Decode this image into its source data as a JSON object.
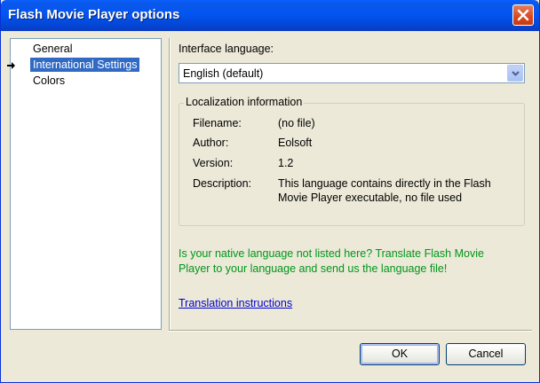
{
  "window": {
    "title": "Flash Movie Player options"
  },
  "nav": {
    "items": [
      {
        "label": "General",
        "selected": false
      },
      {
        "label": "International Settings",
        "selected": true
      },
      {
        "label": "Colors",
        "selected": false
      }
    ]
  },
  "language": {
    "label": "Interface language:",
    "selected": "English (default)"
  },
  "localization": {
    "title": "Localization information",
    "filename_label": "Filename:",
    "filename_value": "(no file)",
    "author_label": "Author:",
    "author_value": "Eolsoft",
    "version_label": "Version:",
    "version_value": "1.2",
    "description_label": "Description:",
    "description_line1": "This language contains directly in the Flash",
    "description_line2": "Movie Player executable, no file used"
  },
  "promo": {
    "line1": "Is your native language not listed here? Translate Flash Movie",
    "line2": "Player to your language and send us the language file!"
  },
  "translation_link": "Translation instructions",
  "buttons": {
    "ok": "OK",
    "cancel": "Cancel"
  },
  "colors": {
    "titlebar": "#0355f3",
    "selection": "#316ac5",
    "promo": "#00961a",
    "link": "#0000cc"
  }
}
